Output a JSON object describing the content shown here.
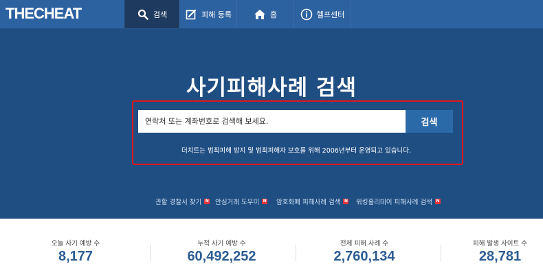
{
  "header": {
    "logo_part1": "THE",
    "logo_part2": "CHEAT",
    "nav": [
      {
        "label": "검색",
        "icon": "search-icon",
        "active": true
      },
      {
        "label": "피해 등록",
        "icon": "edit-icon",
        "active": false
      },
      {
        "label": "홈",
        "icon": "home-icon",
        "active": false
      },
      {
        "label": "헬프센터",
        "icon": "info-icon",
        "active": false
      }
    ]
  },
  "hero": {
    "title": "사기피해사례 검색",
    "search": {
      "placeholder": "연락처 또는 계좌번호로 검색해 보세요.",
      "button_label": "검색"
    },
    "note": "더치트는 범죄피해 방지 및 범죄피해자 보호를 위해 2006년부터 운영되고 있습니다.",
    "links": [
      {
        "label": "관할 경찰서 찾기",
        "badge": "N"
      },
      {
        "label": "안심거래 도우미",
        "badge": "N"
      },
      {
        "label": "암호화폐 피해사례 검색",
        "badge": "N"
      },
      {
        "label": "워킹홀리데이 피해사례 검색",
        "badge": "N"
      }
    ]
  },
  "stats": [
    {
      "label": "오늘 사기 예방 수",
      "value": "8,177"
    },
    {
      "label": "누적 사기 예방 수",
      "value": "60,492,252"
    },
    {
      "label": "전체 피해 사례 수",
      "value": "2,760,134"
    },
    {
      "label": "피해 발생 사이트 수",
      "value": "28,781"
    }
  ],
  "colors": {
    "topbar": "#2d62a1",
    "hero_background": "#1f4e82",
    "active_nav": "#1e3a5f",
    "search_button": "#2b6aa8",
    "highlight_border": "#e3141b",
    "stat_value": "#2c5d92"
  }
}
